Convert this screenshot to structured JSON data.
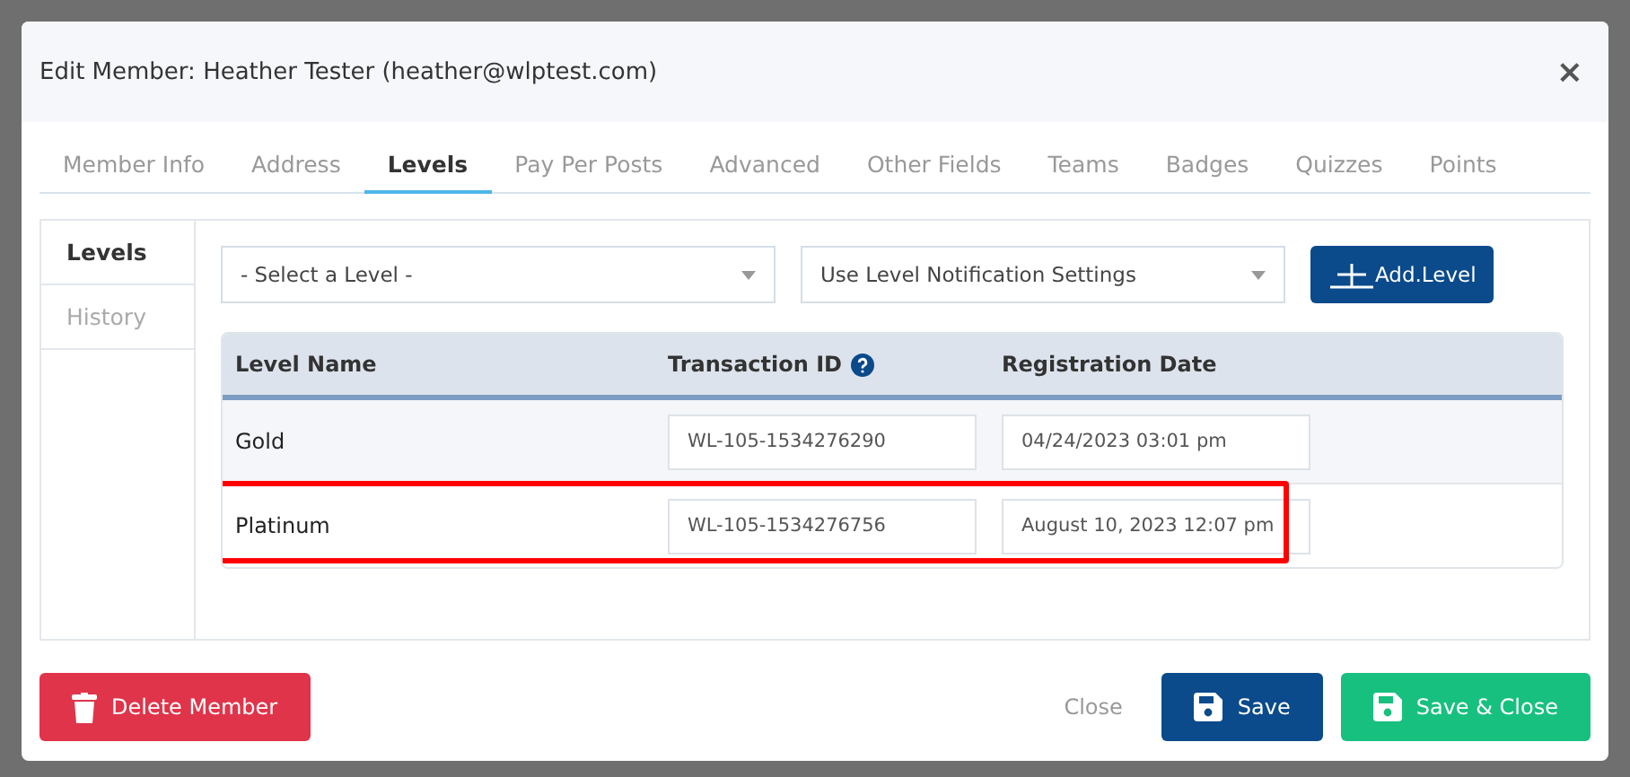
{
  "window": {
    "title": "Edit Member: Heather Tester (heather@wlptest.com)",
    "close": "×"
  },
  "tabs": [
    {
      "label": "Member Info",
      "selected": false
    },
    {
      "label": "Address",
      "selected": false
    },
    {
      "label": "Levels",
      "selected": true
    },
    {
      "label": "Pay Per Posts",
      "selected": false
    },
    {
      "label": "Advanced",
      "selected": false
    },
    {
      "label": "Other Fields",
      "selected": false
    },
    {
      "label": "Teams",
      "selected": false
    },
    {
      "label": "Badges",
      "selected": false
    },
    {
      "label": "Quizzes",
      "selected": false
    },
    {
      "label": "Points",
      "selected": false
    }
  ],
  "sidebar": {
    "items": [
      {
        "label": "Levels",
        "selected": true
      },
      {
        "label": "History",
        "selected": false
      }
    ]
  },
  "level_select": {
    "value": "- Select a Level -"
  },
  "notification_select": {
    "value": "Use Level Notification Settings"
  },
  "add_button": {
    "label": "Add.Level"
  },
  "table": {
    "columns": [
      {
        "label": "Level Name",
        "help": false
      },
      {
        "label": "Transaction ID",
        "help": true
      },
      {
        "label": "Registration Date",
        "help": false
      }
    ],
    "rows": [
      {
        "name": "Gold",
        "transaction_id": "WL-105-1534276290",
        "date": "04/24/2023 03:01 pm",
        "highlighted": false
      },
      {
        "name": "Platinum",
        "transaction_id": "WL-105-1534276756",
        "date": "August 10, 2023 12:07 pm",
        "highlighted": true
      }
    ]
  },
  "footer": {
    "delete": "Delete Member",
    "close": "Close",
    "save": "Save",
    "save_close": "Save & Close"
  }
}
